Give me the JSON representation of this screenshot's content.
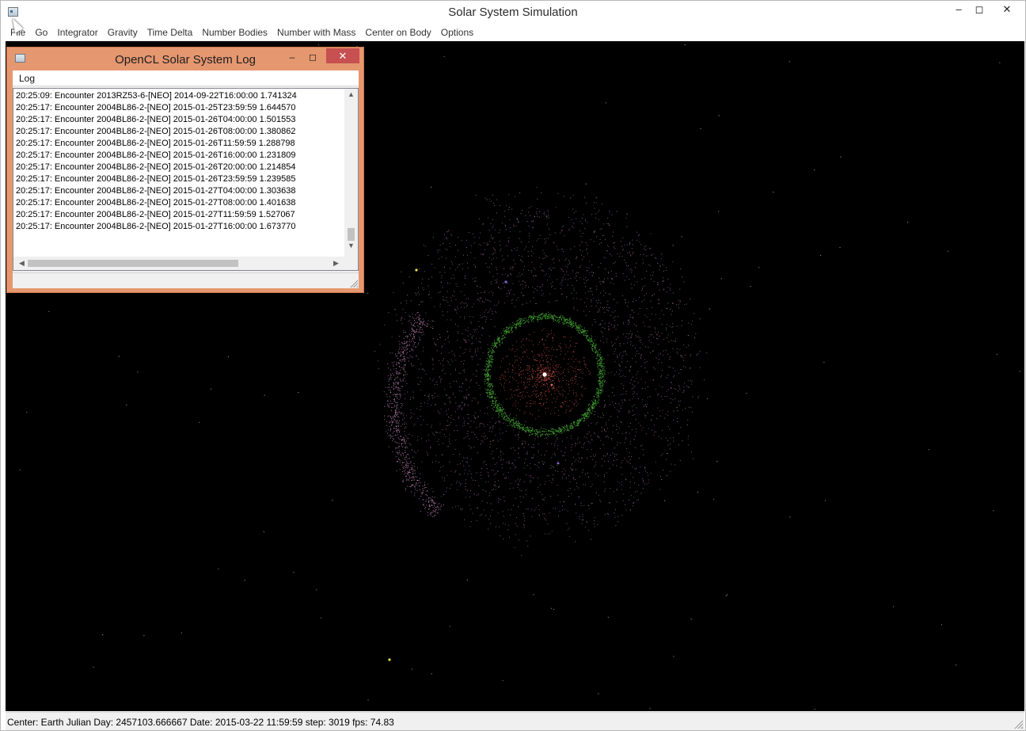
{
  "window": {
    "title": "Solar System Simulation",
    "minimize": "–",
    "maximize": "◻",
    "close": "✕"
  },
  "menu": [
    "File",
    "Go",
    "Integrator",
    "Gravity",
    "Time Delta",
    "Number Bodies",
    "Number with Mass",
    "Center on Body",
    "Options"
  ],
  "log_window": {
    "title": "OpenCL Solar System Log",
    "minimize": "–",
    "maximize": "◻",
    "close": "✕",
    "menu_label": "Log",
    "lines": [
      "20:25:09: Encounter 2013RZ53-6-[NEO] 2014-09-22T16:00:00 1.741324",
      "20:25:17: Encounter 2004BL86-2-[NEO] 2015-01-25T23:59:59 1.644570",
      "20:25:17: Encounter 2004BL86-2-[NEO] 2015-01-26T04:00:00 1.501553",
      "20:25:17: Encounter 2004BL86-2-[NEO] 2015-01-26T08:00:00 1.380862",
      "20:25:17: Encounter 2004BL86-2-[NEO] 2015-01-26T11:59:59 1.288798",
      "20:25:17: Encounter 2004BL86-2-[NEO] 2015-01-26T16:00:00 1.231809",
      "20:25:17: Encounter 2004BL86-2-[NEO] 2015-01-26T20:00:00 1.214854",
      "20:25:17: Encounter 2004BL86-2-[NEO] 2015-01-26T23:59:59 1.239585",
      "20:25:17: Encounter 2004BL86-2-[NEO] 2015-01-27T04:00:00 1.303638",
      "20:25:17: Encounter 2004BL86-2-[NEO] 2015-01-27T08:00:00 1.401638",
      "20:25:17: Encounter 2004BL86-2-[NEO] 2015-01-27T11:59:59 1.527067",
      "20:25:17: Encounter 2004BL86-2-[NEO] 2015-01-27T16:00:00 1.673770"
    ],
    "arrows": {
      "up": "▲",
      "down": "▼",
      "left": "◀",
      "right": "▶"
    }
  },
  "status": {
    "text": "Center: Earth Julian Day: 2457103.666667 Date: 2015-03-22 11:59:59 step: 3019 fps: 74.83"
  },
  "colors": {
    "log_frame": "#e59770",
    "close_button": "#c75050",
    "sim_background": "#000000",
    "inner_ring": "#3f9a2f",
    "inner_region": "#b8473f",
    "outer_cloud": "#b06aa8"
  },
  "icons": [
    "app-icon",
    "log-app-icon",
    "cursor-icon"
  ]
}
